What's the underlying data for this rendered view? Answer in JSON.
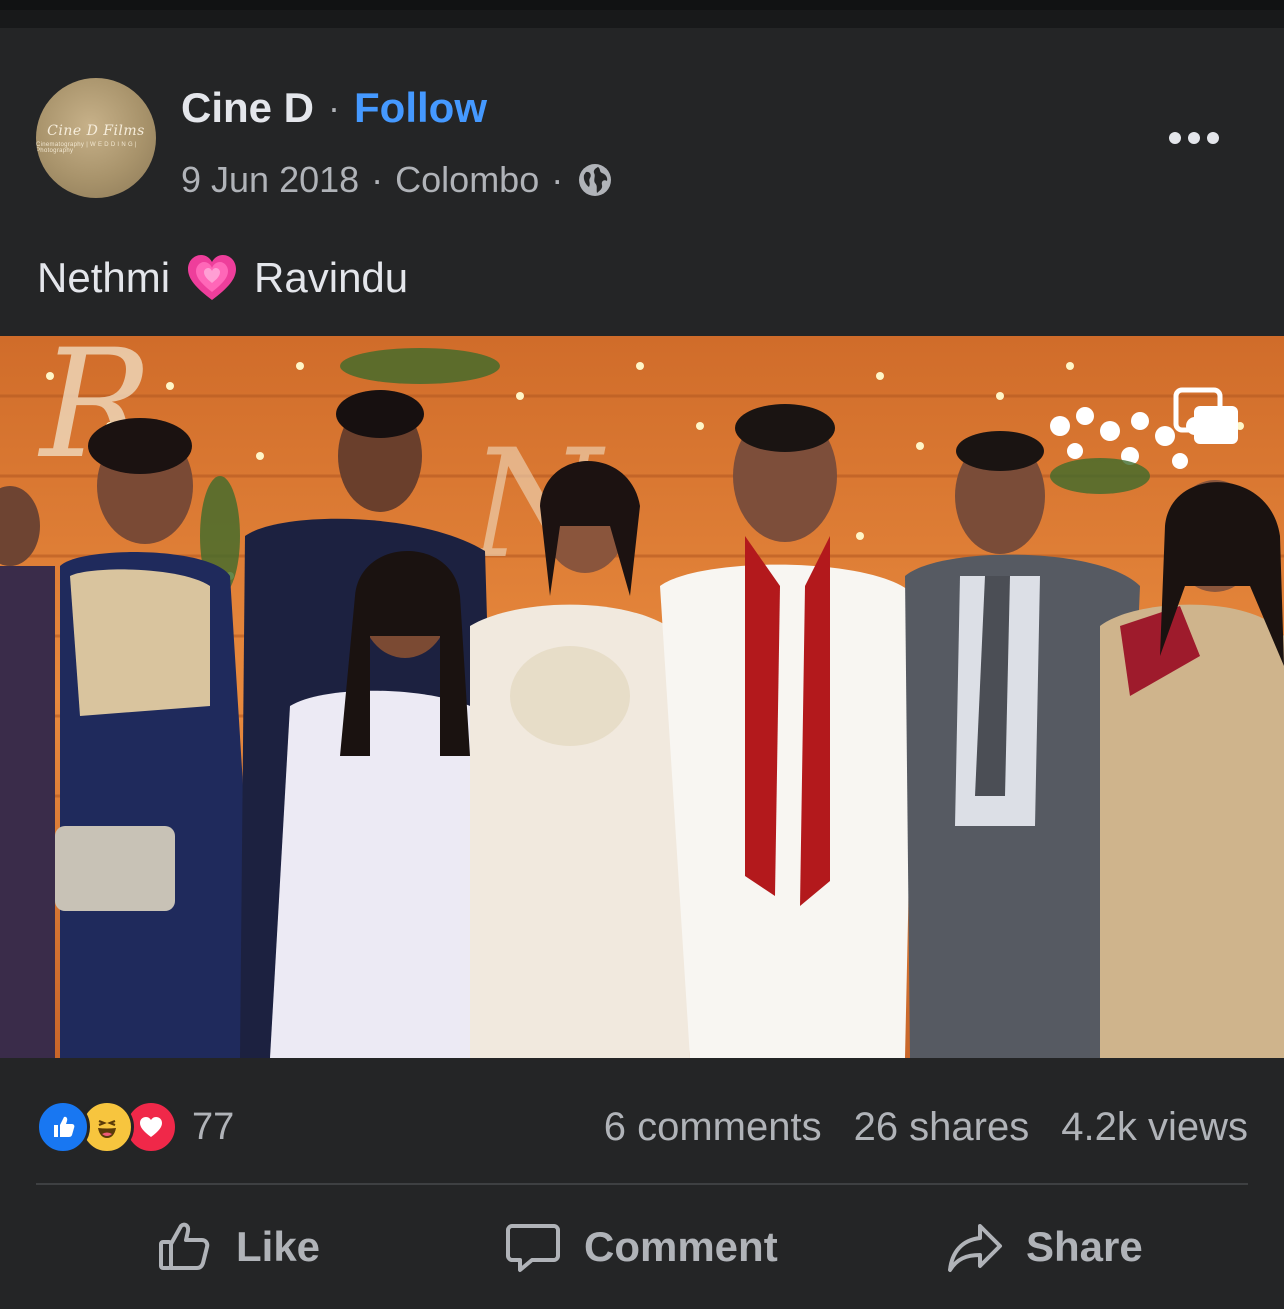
{
  "post": {
    "author": "Cine D",
    "separator": "·",
    "follow_label": "Follow",
    "date": "9 Jun 2018",
    "location": "Colombo",
    "audience_icon": "globe-icon",
    "more_icon": "more-options-icon",
    "caption_part1": "Nethmi",
    "caption_emoji": "growing-heart-emoji",
    "caption_part2": "Ravindu"
  },
  "avatar": {
    "logo_text": "Cine D Films",
    "logo_sub": "Cinematography | W E D D I N G | Photography"
  },
  "photo": {
    "description_icon": "multi-photo-icon"
  },
  "engagement": {
    "reactions": [
      "like",
      "haha",
      "love"
    ],
    "reaction_count": "77",
    "comments": "6 comments",
    "shares": "26 shares",
    "views": "4.2k views"
  },
  "actions": {
    "like": "Like",
    "comment": "Comment",
    "share": "Share"
  },
  "colors": {
    "background": "#242526",
    "accent": "#4599ff",
    "text_primary": "#e4e6eb",
    "text_secondary": "#b0b3b8"
  }
}
